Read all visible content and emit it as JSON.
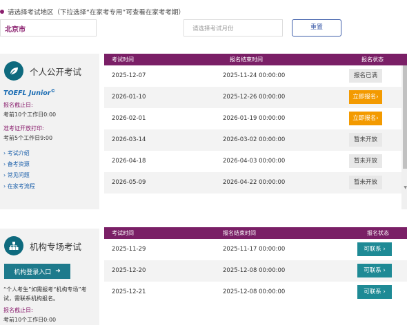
{
  "filter": {
    "prompt": "请选择考试地区（下拉选择“在家考专用”可查看在家考考期）",
    "region_value": "北京市",
    "month_placeholder": "请选择考试月份",
    "reset_label": "重置"
  },
  "individual": {
    "title": "个人公开考试",
    "exam_name": "TOEFL Junior",
    "exam_mark": "©",
    "deadline_label": "报名截止日:",
    "deadline_value": "考前10个工作日0:00",
    "admission_label": "准考证开放打印:",
    "admission_value": "考前5个工作日9:00",
    "links": [
      "› 考试介绍",
      "› 备考资源",
      "› 常见问题",
      "› 在家考流程"
    ],
    "table": {
      "headers": [
        "考试时间",
        "报名结束时间",
        "报名状态"
      ],
      "rows": [
        {
          "date": "2025-12-07",
          "end": "2025-11-24 00:00:00",
          "status": "报名已满",
          "kind": "full"
        },
        {
          "date": "2026-01-10",
          "end": "2025-12-26 00:00:00",
          "status": "立即报名›",
          "kind": "open"
        },
        {
          "date": "2026-02-01",
          "end": "2026-01-19 00:00:00",
          "status": "立即报名›",
          "kind": "open"
        },
        {
          "date": "2026-03-14",
          "end": "2026-03-02 00:00:00",
          "status": "暂未开放",
          "kind": "closed"
        },
        {
          "date": "2026-04-18",
          "end": "2026-04-03 00:00:00",
          "status": "暂未开放",
          "kind": "closed"
        },
        {
          "date": "2026-05-09",
          "end": "2026-04-22 00:00:00",
          "status": "暂未开放",
          "kind": "closed"
        }
      ]
    }
  },
  "institution": {
    "title": "机构专场考试",
    "login_label": "机构登录入口",
    "note": "“个人考生”如需报考“机构专场”考试，需联系机构报名。",
    "deadline_label": "报名截止日:",
    "deadline_value": "考前10个工作日0:00",
    "table": {
      "headers": [
        "考试时间",
        "报名结束时间",
        "报名状态"
      ],
      "rows": [
        {
          "date": "2025-11-29",
          "end": "2025-11-17 00:00:00",
          "status": "可联系 ›"
        },
        {
          "date": "2025-12-20",
          "end": "2025-12-08 00:00:00",
          "status": "可联系 ›"
        },
        {
          "date": "2025-12-21",
          "end": "2025-12-08 00:00:00",
          "status": "可联系 ›"
        }
      ]
    }
  },
  "colors": {
    "brand": "#7a1f66",
    "accent": "#1e7a8c",
    "orange": "#f39a00",
    "link": "#1a5faa"
  }
}
